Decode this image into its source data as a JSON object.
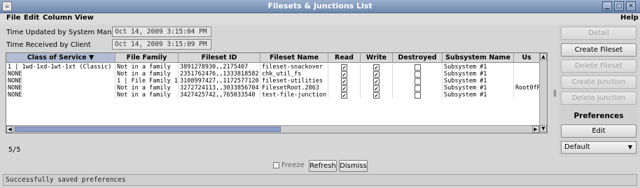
{
  "window": {
    "title": "Filesets & Junctions List",
    "app_icon": "java-icon",
    "controls": [
      "minimize-icon",
      "maximize-icon",
      "close-icon"
    ]
  },
  "menubar": {
    "file": "File",
    "edit": "Edit",
    "column_view": "Column View",
    "help": "Help"
  },
  "info": {
    "updated_label": "Time Updated by System Manager",
    "updated_value": "Oct 14, 2009 3:15:04 PM",
    "received_label": "Time Received by Client",
    "received_value": "Oct 14, 2009 3:15:09 PM"
  },
  "table": {
    "columns": [
      "Class of Service ▼",
      "File Family",
      "Fileset ID",
      "Fileset Name",
      "Read",
      "Write",
      "Destroyed",
      "Subsystem Name",
      "Us"
    ],
    "sorted_column": 0,
    "rows": [
      {
        "cos": "1 | 1wd-1xd-1wt-1xt (Classic)",
        "family": "Not in a family",
        "id": "3891278930,,2175407",
        "name": "fileset-snackover",
        "read": true,
        "write": true,
        "destroyed": false,
        "subsystem": "Subsystem #1",
        "us": ""
      },
      {
        "cos": "NONE",
        "family": "Not in a family",
        "id": "2351762476,,1333818582",
        "name": "chk_util_fs",
        "read": true,
        "write": true,
        "destroyed": false,
        "subsystem": "Subsystem #1",
        "us": ""
      },
      {
        "cos": "NONE",
        "family": "1 | File Family 1",
        "id": "3108997427,,1172577120",
        "name": "fileset-utilities",
        "read": true,
        "write": true,
        "destroyed": false,
        "subsystem": "Subsystem #1",
        "us": ""
      },
      {
        "cos": "NONE",
        "family": "Not in a family",
        "id": "3272724113,,3033856704",
        "name": "FilesetRoot.2863",
        "read": true,
        "write": true,
        "destroyed": false,
        "subsystem": "Subsystem #1",
        "us": "Root0fR"
      },
      {
        "cos": "NONE",
        "family": "Not in a family",
        "id": "3427425742,,765033540",
        "name": "test-file-junction",
        "read": true,
        "write": true,
        "destroyed": false,
        "subsystem": "Subsystem #1",
        "us": ""
      }
    ],
    "row_count": "5/5"
  },
  "side_panel": {
    "detail": "Detail",
    "create_fileset": "Create Fileset",
    "delete_fileset": "Delete Fileset",
    "create_junction": "Create Junction",
    "delete_junction": "Delete Junction",
    "preferences": "Preferences",
    "edit": "Edit",
    "preference_select": "Default"
  },
  "bottom": {
    "freeze": "Freeze",
    "freeze_checked": false,
    "refresh": "Refresh",
    "dismiss": "Dismiss"
  },
  "status": "Successfully saved preferences"
}
